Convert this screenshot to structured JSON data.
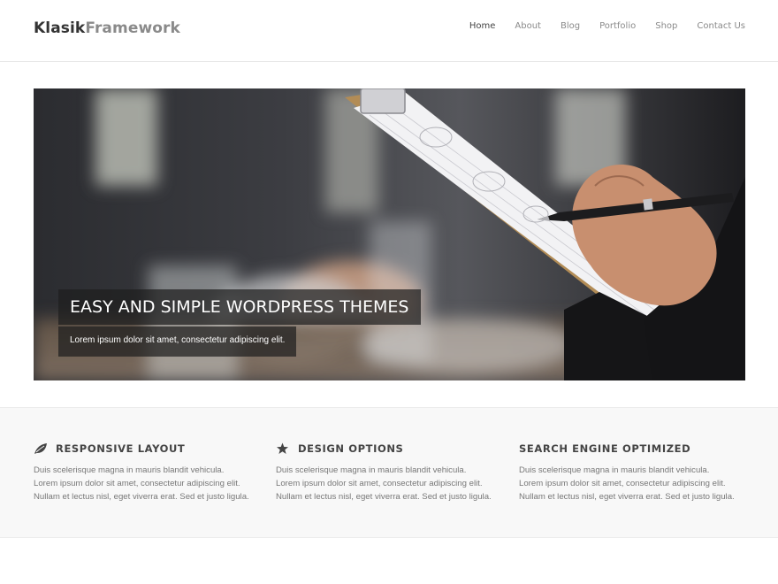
{
  "header": {
    "logo_bold": "Klasik",
    "logo_light": "Framework",
    "nav": [
      "Home",
      "About",
      "Blog",
      "Portfolio",
      "Shop",
      "Contact Us"
    ]
  },
  "hero": {
    "title": "EASY AND SIMPLE WORDPRESS THEMES",
    "subtitle": "Lorem ipsum dolor sit amet, consectetur adipiscing elit."
  },
  "features": [
    {
      "icon": "leaf-icon",
      "title": "RESPONSIVE LAYOUT",
      "text": "Duis scelerisque magna in mauris blandit vehicula. Lorem ipsum dolor sit amet, consectetur adipiscing elit. Nullam et lectus nisl, eget viverra erat. Sed et justo ligula."
    },
    {
      "icon": "star-icon",
      "title": "DESIGN OPTIONS",
      "text": "Duis scelerisque magna in mauris blandit vehicula. Lorem ipsum dolor sit amet, consectetur adipiscing elit. Nullam et lectus nisl, eget viverra erat. Sed et justo ligula."
    },
    {
      "icon": "",
      "title": "SEARCH ENGINE OPTIMIZED",
      "text": "Duis scelerisque magna in mauris blandit vehicula. Lorem ipsum dolor sit amet, consectetur adipiscing elit. Nullam et lectus nisl, eget viverra erat. Sed et justo ligula."
    }
  ],
  "colors": {
    "heading": "#444444",
    "body_text": "#777777",
    "nav_text": "#8a8a8a",
    "band_bg": "#f8f8f8"
  }
}
